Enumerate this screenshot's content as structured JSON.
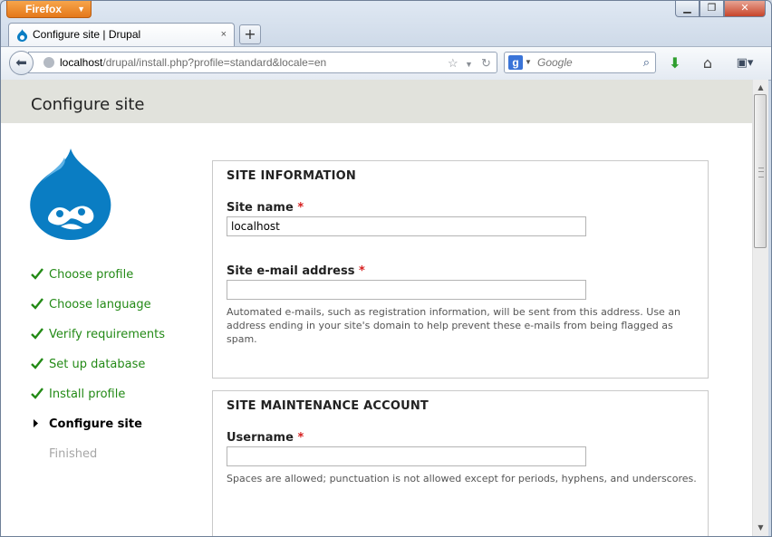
{
  "browser": {
    "menu_button": "Firefox",
    "tab_title": "Configure site | Drupal",
    "url_host": "localhost",
    "url_path": "/drupal/install.php?profile=standard&locale=en",
    "search_placeholder": "Google",
    "window_buttons": [
      "minimize",
      "maximize",
      "close"
    ]
  },
  "page": {
    "header_title": "Configure site",
    "steps": [
      {
        "label": "Choose profile",
        "state": "done"
      },
      {
        "label": "Choose language",
        "state": "done"
      },
      {
        "label": "Verify requirements",
        "state": "done"
      },
      {
        "label": "Set up database",
        "state": "done"
      },
      {
        "label": "Install profile",
        "state": "done"
      },
      {
        "label": "Configure site",
        "state": "active"
      },
      {
        "label": "Finished",
        "state": "pending"
      }
    ],
    "site_info": {
      "legend": "SITE INFORMATION",
      "site_name_label": "Site name",
      "site_name_value": "localhost",
      "email_label": "Site e-mail address",
      "email_value": "",
      "email_description": "Automated e-mails, such as registration information, will be sent from this address. Use an address ending in your site's domain to help prevent these e-mails from being flagged as spam."
    },
    "maintenance": {
      "legend": "SITE MAINTENANCE ACCOUNT",
      "username_label": "Username",
      "username_value": "",
      "username_description": "Spaces are allowed; punctuation is not allowed except for periods, hyphens, and underscores."
    },
    "required_marker": "*"
  },
  "colors": {
    "done_step": "#238a16",
    "header_bg": "#e1e2dc",
    "required": "#d61e1e",
    "drupal_blue": "#0a7dc3"
  }
}
